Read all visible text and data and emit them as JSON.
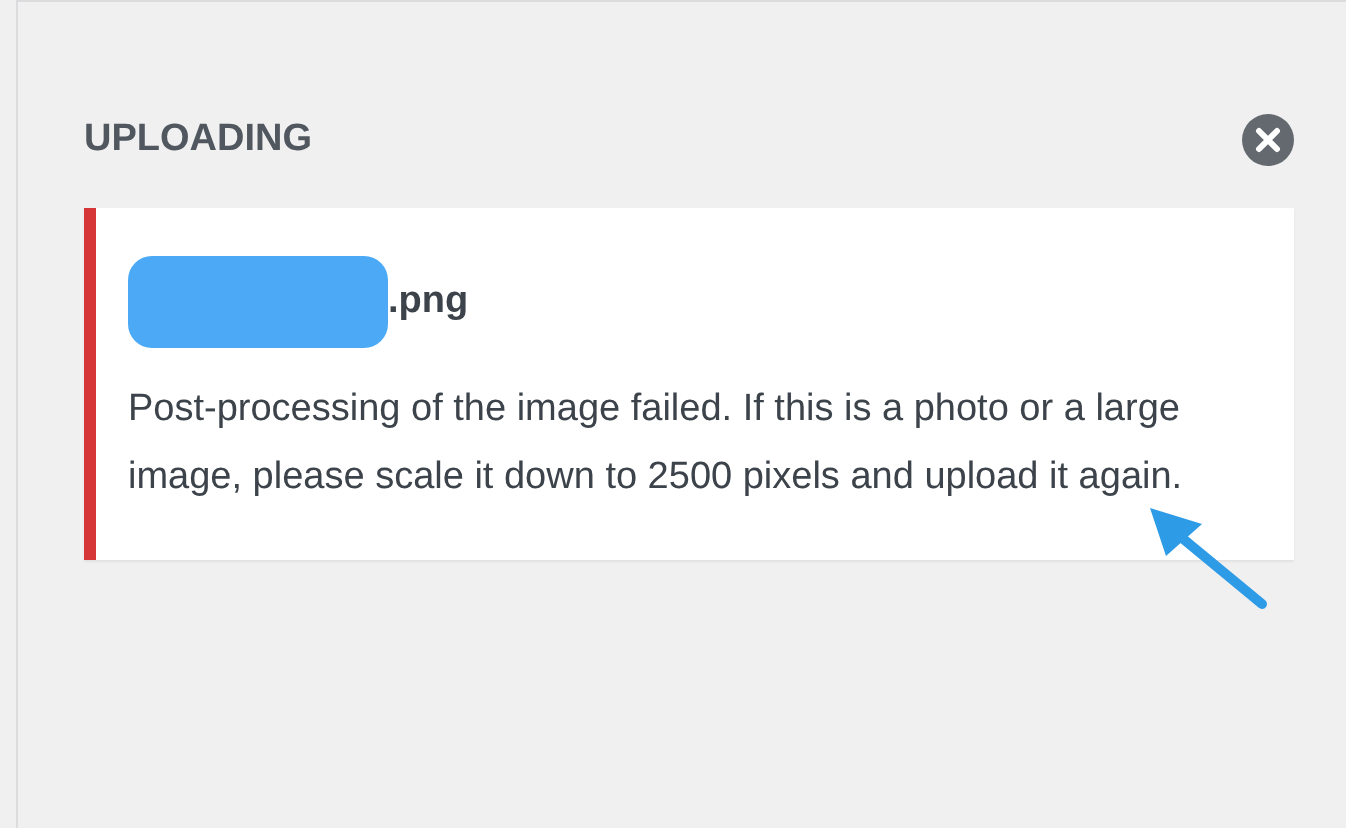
{
  "panel": {
    "title": "UPLOADING"
  },
  "upload": {
    "failed": true,
    "filename": ".png",
    "message": "Post-processing of the image failed. If this is a photo or a large image, please scale it down to 2500 pixels and upload it again."
  }
}
